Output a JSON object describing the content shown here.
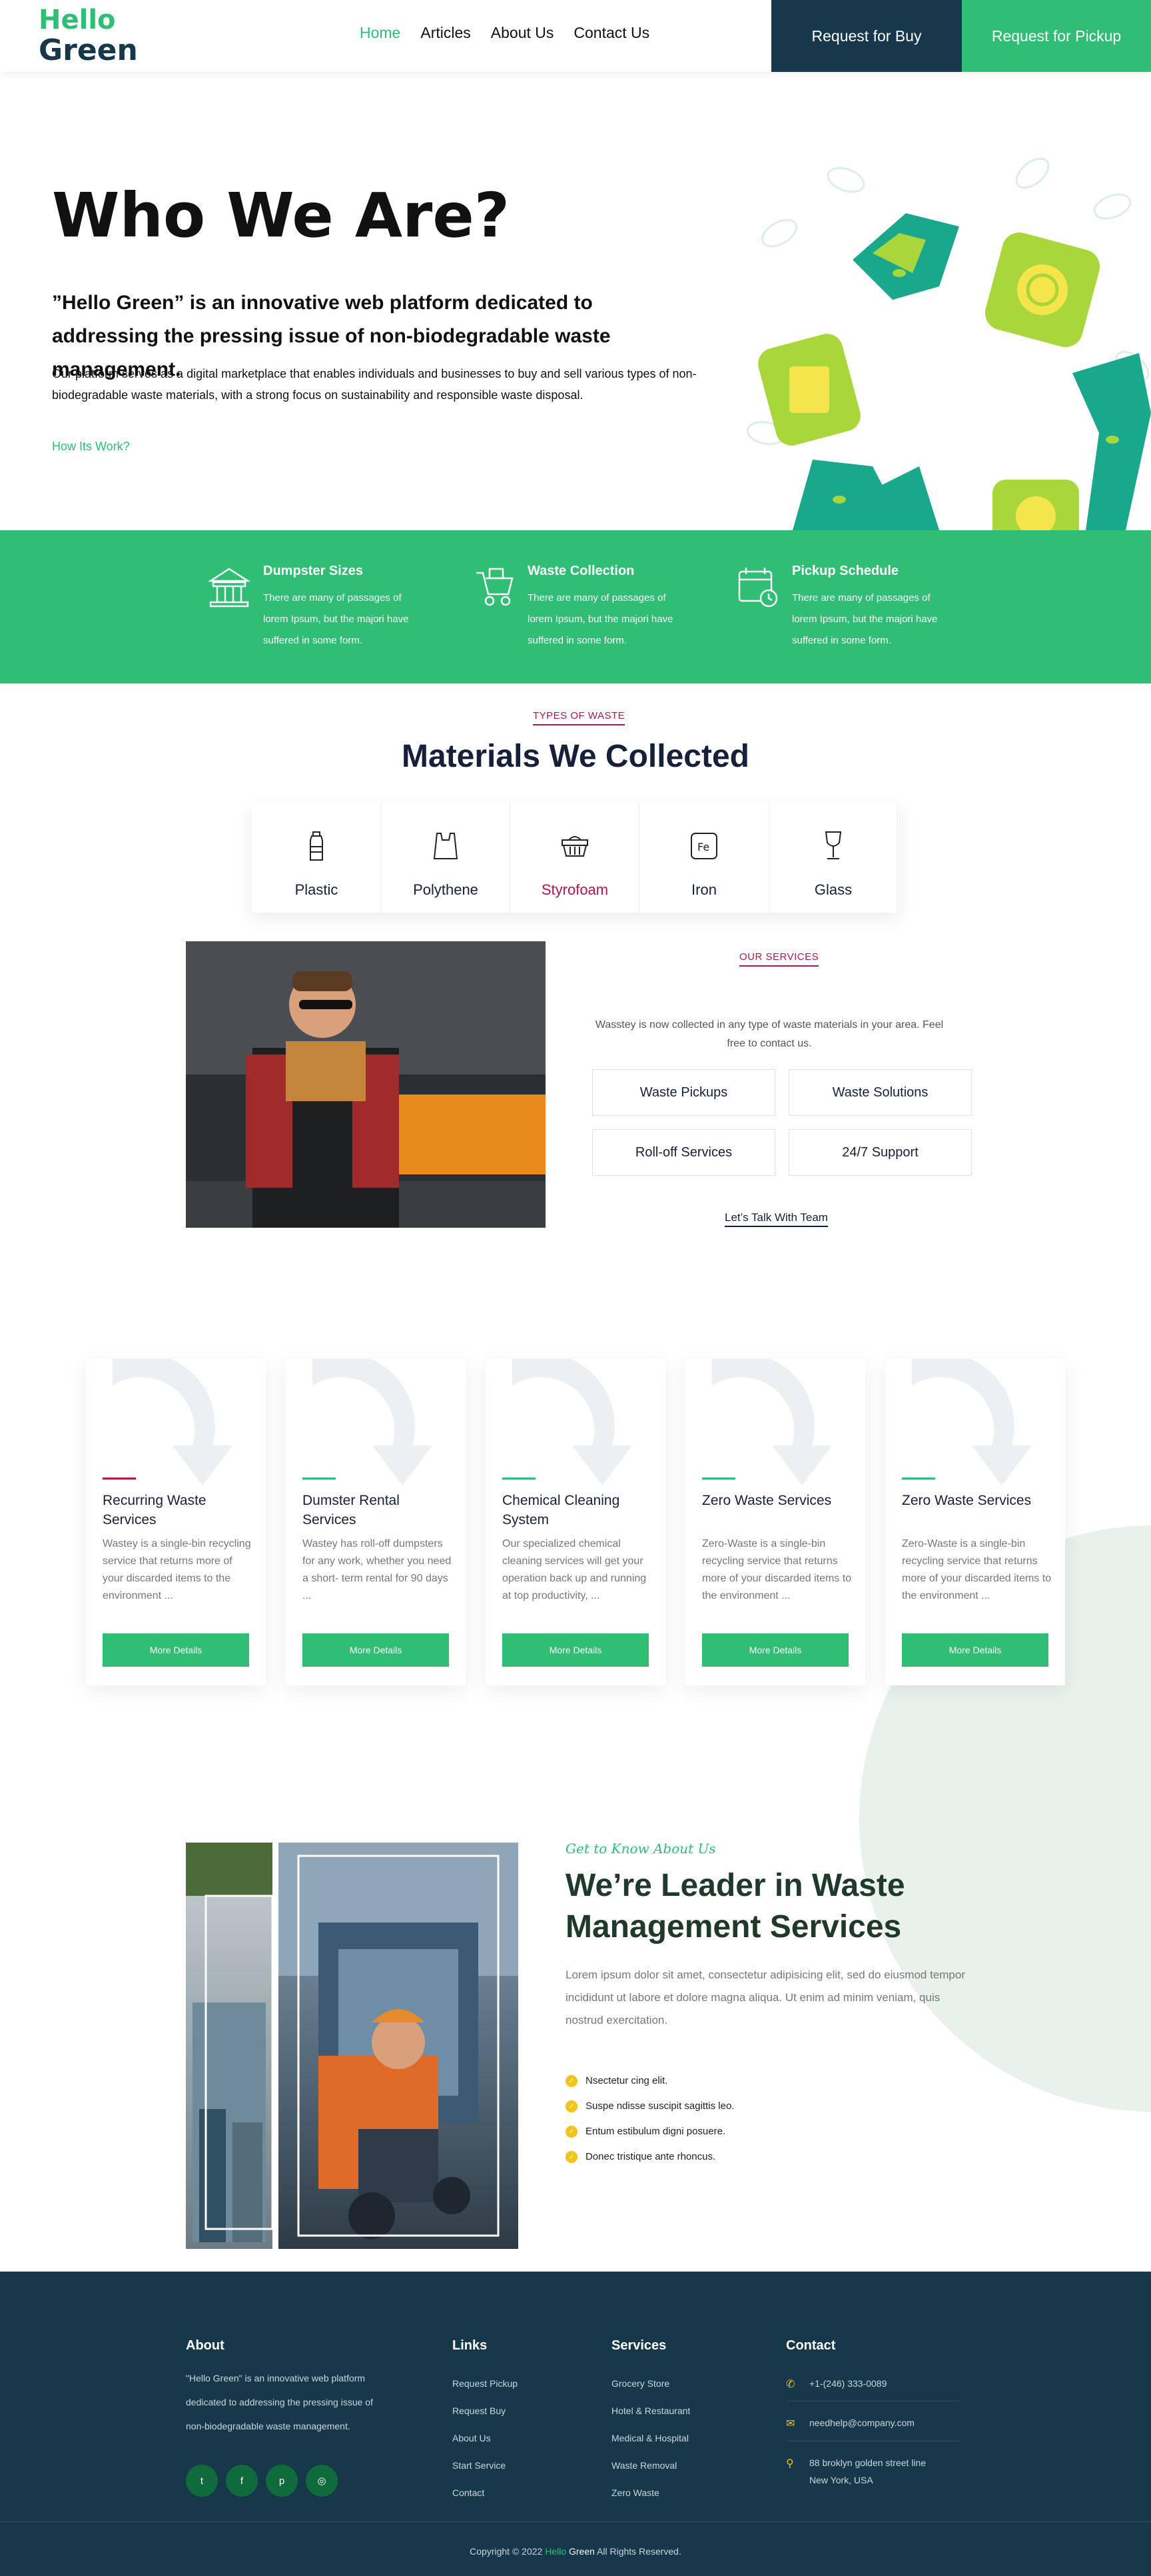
{
  "header": {
    "logo_line1": "Hello",
    "logo_line2": "Green",
    "nav": [
      "Home",
      "Articles",
      "About Us",
      "Contact Us"
    ],
    "request_buy": "Request for Buy",
    "request_pickup": "Request for Pickup"
  },
  "hero": {
    "title": "Who We Are?",
    "subtitle": "”Hello Green” is an innovative web platform dedicated to addressing the pressing issue of non-biodegradable waste management.",
    "description": "Our platform serves as a digital marketplace that enables individuals and businesses to buy and sell various types of non-biodegradable waste materials, with a strong focus on sustainability and responsible waste disposal.",
    "link": "How Its Work?"
  },
  "features": [
    {
      "title": "Dumpster Sizes",
      "desc": "There are many of passages of lorem Ipsum, but the majori have suffered in some form.",
      "icon": "building-icon"
    },
    {
      "title": "Waste Collection",
      "desc": "There are many of passages of lorem Ipsum, but the majori have suffered in some form.",
      "icon": "cart-icon"
    },
    {
      "title": "Pickup Schedule",
      "desc": "There are many of passages of lorem Ipsum, but the majori have suffered in some form.",
      "icon": "calendar-icon"
    }
  ],
  "materials": {
    "eyebrow": "TYPES OF WASTE",
    "title": "Materials We Collected",
    "items": [
      "Plastic",
      "Polythene",
      "Styrofoam",
      "Iron",
      "Glass"
    ]
  },
  "services": {
    "eyebrow": "OUR SERVICES",
    "description": "Wasstey is now collected in any type of waste materials in your area. Feel free to contact us.",
    "buttons": [
      "Waste Pickups",
      "Waste Solutions",
      "Roll-off Services",
      "24/7 Support"
    ],
    "cta": "Let’s Talk With Team"
  },
  "cards": [
    {
      "title": "Recurring Waste Services",
      "desc": "Wastey is a single-bin recycling service that returns more of your discarded items to the environment ...",
      "button": "More Details"
    },
    {
      "title": "Dumster Rental Services",
      "desc": "Wastey has roll-off dumpsters for any work, whether you need a short- term rental for 90 days ...",
      "button": "More Details"
    },
    {
      "title": "Chemical Cleaning System",
      "desc": "Our specialized chemical cleaning services will get your operation back up and running at top productivity, ...",
      "button": "More Details"
    },
    {
      "title": "Zero Waste Services",
      "desc": "Zero-Waste is a single-bin recycling service that returns more of your discarded items to the environment ...",
      "button": "More Details"
    },
    {
      "title": "Zero Waste Services",
      "desc": "Zero-Waste is a single-bin recycling service that returns more of your discarded items to the environment ...",
      "button": "More Details"
    }
  ],
  "leader": {
    "eyebrow": "Get to Know About Us",
    "title": "We’re Leader in Waste Management Services",
    "description": "Lorem ipsum dolor sit amet, consectetur adipisicing elit, sed do eiusmod tempor incididunt ut labore et dolore magna aliqua. Ut enim ad minim veniam, quis nostrud exercitation.",
    "list": [
      "Nsectetur cing elit.",
      "Suspe ndisse suscipit sagittis leo.",
      "Entum estibulum digni posuere.",
      "Donec tristique ante rhoncus."
    ]
  },
  "footer": {
    "about_title": "About",
    "about_text": "\"Hello Green\" is an innovative web platform dedicated to addressing the pressing issue of non-biodegradable waste management.",
    "links_title": "Links",
    "links": [
      "Request Pickup",
      "Request Buy",
      "About Us",
      "Start Service",
      "Contact"
    ],
    "services_title": "Services",
    "services": [
      "Grocery Store",
      "Hotel & Restaurant",
      "Medical & Hospital",
      "Waste Removal",
      "Zero Waste"
    ],
    "contact_title": "Contact",
    "phone": "+1-(246) 333-0089",
    "email": "needhelp@company.com",
    "address": "88 broklyn golden street line New York, USA",
    "social": [
      "twitter-icon",
      "facebook-icon",
      "pinterest-icon",
      "instagram-icon"
    ],
    "copyright_pre": "Copyright © 2022",
    "copyright_brand1": "Hello",
    "copyright_brand2": "Green",
    "copyright_post": "All Rights Reserved."
  },
  "colors": {
    "green": "#2fbe74",
    "navy": "#16384a",
    "crimson": "#b0154c",
    "yellow": "#f2c318"
  }
}
